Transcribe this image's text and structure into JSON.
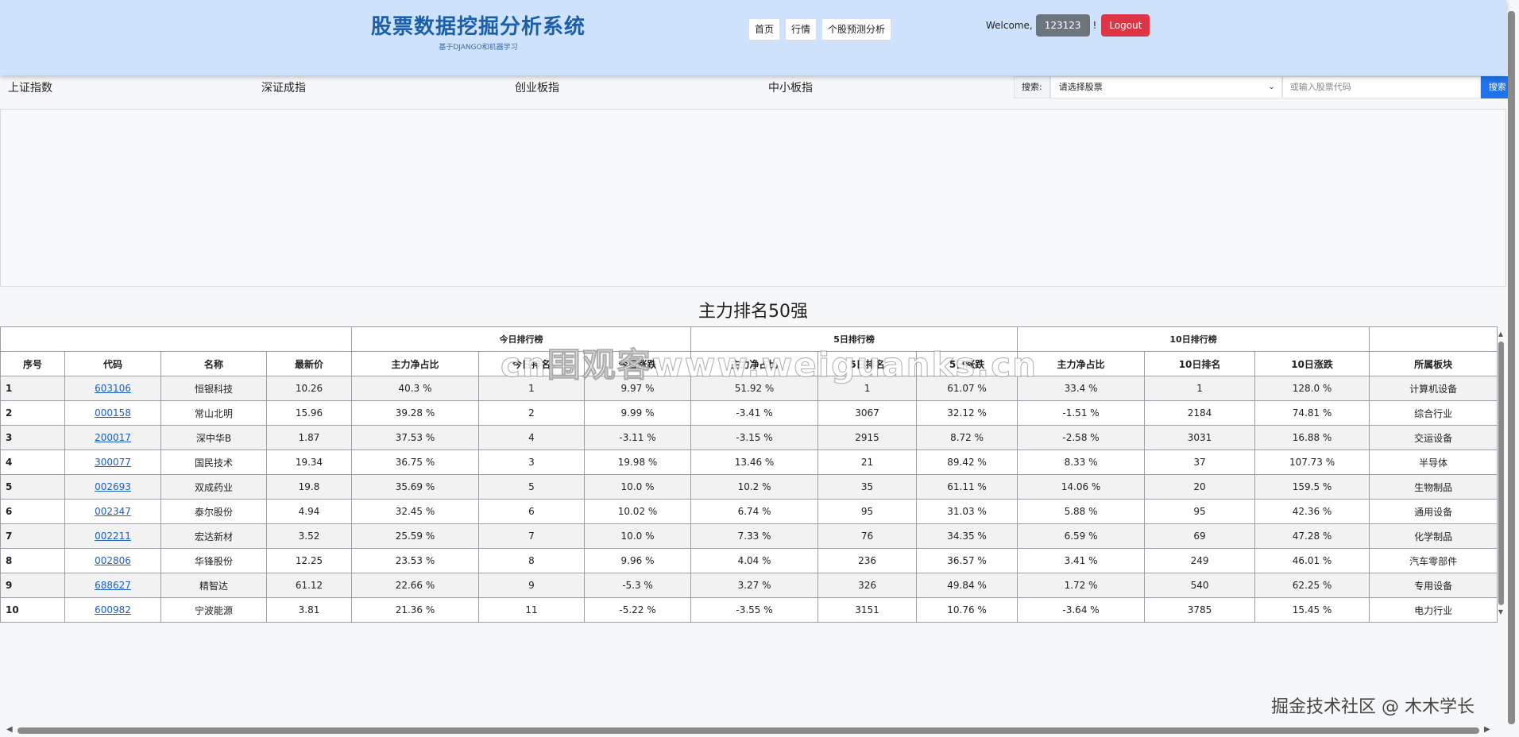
{
  "header": {
    "brand_title": "股票数据挖掘分析系统",
    "brand_subtitle": "基于DJANGO和机器学习",
    "nav": [
      "首页",
      "行情",
      "个股预测分析"
    ],
    "welcome": "Welcome,",
    "username": "123123",
    "exclamation": "!",
    "logout": "Logout"
  },
  "indices": [
    "上证指数",
    "深证成指",
    "创业板指",
    "中小板指"
  ],
  "search": {
    "label": "搜索:",
    "select_value": "请选择股票",
    "input_placeholder": "或输入股票代码",
    "button": "搜索"
  },
  "table": {
    "title": "主力排名50强",
    "group_headers": [
      "今日排行榜",
      "5日排行榜",
      "10日排行榜"
    ],
    "columns": [
      "序号",
      "代码",
      "名称",
      "最新价",
      "主力净占比",
      "今日排名",
      "今日涨跌",
      "主力净占比",
      "5日排名",
      "5日涨跌",
      "主力净占比",
      "10日排名",
      "10日涨跌",
      "所属板块"
    ],
    "rows": [
      [
        "1",
        "603106",
        "恒银科技",
        "10.26",
        "40.3 %",
        "1",
        "9.97 %",
        "51.92 %",
        "1",
        "61.07 %",
        "33.4 %",
        "1",
        "128.0 %",
        "计算机设备"
      ],
      [
        "2",
        "000158",
        "常山北明",
        "15.96",
        "39.28 %",
        "2",
        "9.99 %",
        "-3.41 %",
        "3067",
        "32.12 %",
        "-1.51 %",
        "2184",
        "74.81 %",
        "综合行业"
      ],
      [
        "3",
        "200017",
        "深中华B",
        "1.87",
        "37.53 %",
        "4",
        "-3.11 %",
        "-3.15 %",
        "2915",
        "8.72 %",
        "-2.58 %",
        "3031",
        "16.88 %",
        "交运设备"
      ],
      [
        "4",
        "300077",
        "国民技术",
        "19.34",
        "36.75 %",
        "3",
        "19.98 %",
        "13.46 %",
        "21",
        "89.42 %",
        "8.33 %",
        "37",
        "107.73 %",
        "半导体"
      ],
      [
        "5",
        "002693",
        "双成药业",
        "19.8",
        "35.69 %",
        "5",
        "10.0 %",
        "10.2 %",
        "35",
        "61.11 %",
        "14.06 %",
        "20",
        "159.5 %",
        "生物制品"
      ],
      [
        "6",
        "002347",
        "泰尔股份",
        "4.94",
        "32.45 %",
        "6",
        "10.02 %",
        "6.74 %",
        "95",
        "31.03 %",
        "5.88 %",
        "95",
        "42.36 %",
        "通用设备"
      ],
      [
        "7",
        "002211",
        "宏达新材",
        "3.52",
        "25.59 %",
        "7",
        "10.0 %",
        "7.33 %",
        "76",
        "34.35 %",
        "6.59 %",
        "69",
        "47.28 %",
        "化学制品"
      ],
      [
        "8",
        "002806",
        "华锋股份",
        "12.25",
        "23.53 %",
        "8",
        "9.96 %",
        "4.04 %",
        "236",
        "36.57 %",
        "3.41 %",
        "249",
        "46.01 %",
        "汽车零部件"
      ],
      [
        "9",
        "688627",
        "精智达",
        "61.12",
        "22.66 %",
        "9",
        "-5.3 %",
        "3.27 %",
        "326",
        "49.84 %",
        "1.72 %",
        "540",
        "62.25 %",
        "专用设备"
      ],
      [
        "10",
        "600982",
        "宁波能源",
        "3.81",
        "21.36 %",
        "11",
        "-5.22 %",
        "-3.55 %",
        "3151",
        "10.76 %",
        "-3.64 %",
        "3785",
        "15.45 %",
        "电力行业"
      ]
    ]
  },
  "watermark": "cn围观客www.weiguanks.cn",
  "credit": "掘金技术社区 @ 木木学长"
}
